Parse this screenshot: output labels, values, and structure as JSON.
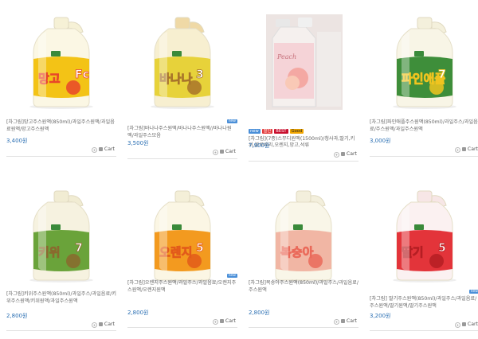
{
  "products": [
    {
      "title": "[차그림]망고주스원액(850ml)/과일주스원액/과일음료원액/망고주스원액",
      "price": "3,400원",
      "cart": "Cart",
      "label_text": "망고",
      "label_num": "Fc",
      "colors": {
        "cap": "#f6f1d6",
        "body": "#fbf7e4",
        "label": "#f3c316",
        "accent": "#e8462a"
      },
      "badges": []
    },
    {
      "title": "[차그림]바나나주스원액/바나나주스원액//바나나원액/과일주스모음",
      "price": "3,500원",
      "cart": "Cart",
      "label_text": "바나나",
      "label_num": "3",
      "colors": {
        "cap": "#efd9a6",
        "body": "#f7efd0",
        "label": "#e7d23a",
        "accent": "#a8742a"
      },
      "badges": [
        "new"
      ]
    },
    {
      "title": "[차그림](7종)스무디원액(1500ml)/청사과,딸기,키위,블루베리,오렌지,망고,석류",
      "price": "7,900원",
      "cart": "Cart",
      "label_text": "Peach",
      "label_num": "",
      "colors": {
        "cap": "#f2f2f2",
        "body": "#f8f4f2",
        "label": "#f5d3d7",
        "accent": "#e8a7b0"
      },
      "badges": [
        "new",
        "할인",
        "BEST",
        "Good"
      ]
    },
    {
      "title": "[차그림]파인애플주스원액(850ml)/과일주스/과일음료/주스원액/과일주스원액",
      "price": "3,000원",
      "cart": "Cart",
      "label_text": "파인애플",
      "label_num": "7",
      "colors": {
        "cap": "#f4f0dc",
        "body": "#f8f5e6",
        "label": "#3e8e3a",
        "accent": "#f0c41f"
      },
      "badges": []
    },
    {
      "title": "[차그림]키위주스원액(850ml)/과일주스/과일음료/키위주스원액/키위원액/과일주스원액",
      "price": "2,800원",
      "cart": "Cart",
      "label_text": "키위",
      "label_num": "7",
      "colors": {
        "cap": "#f1ecd3",
        "body": "#f6f2e0",
        "label": "#6aa33a",
        "accent": "#8a6a2e"
      },
      "badges": []
    },
    {
      "title": "[차그림]오렌지주스원액/과일주스/과일음료/오렌지주스원액/오렌지원액",
      "price": "2,800원",
      "cart": "Cart",
      "label_text": "오렌지",
      "label_num": "5",
      "colors": {
        "cap": "#f4efd8",
        "body": "#fbf6e4",
        "label": "#f39a1f",
        "accent": "#e25a1a"
      },
      "badges": [
        "new"
      ]
    },
    {
      "title": "[차그림]복숭아주스원액(850ml)/과일주스/과일음료/주스원액",
      "price": "2,800원",
      "cart": "Cart",
      "label_text": "복숭아",
      "label_num": "",
      "colors": {
        "cap": "#f3efdc",
        "body": "#f9f6e8",
        "label": "#f1b6a4",
        "accent": "#ea6a5a"
      },
      "badges": []
    },
    {
      "title": "[차그림] 딸기주스원액(850ml)/과일주스/과일음료/주스원액/딸기원액/딸기주스원액",
      "price": "3,200원",
      "cart": "Cart",
      "label_text": "딸기",
      "label_num": "5",
      "colors": {
        "cap": "#f7e6e6",
        "body": "#fbf1f1",
        "label": "#e3343a",
        "accent": "#b51e23"
      },
      "badges": [
        "new"
      ]
    }
  ],
  "badge_colors": {
    "new": "#4a8fd8",
    "할인": "#e23b3b",
    "BEST": "#c8102e",
    "Good": "#f0a500"
  }
}
